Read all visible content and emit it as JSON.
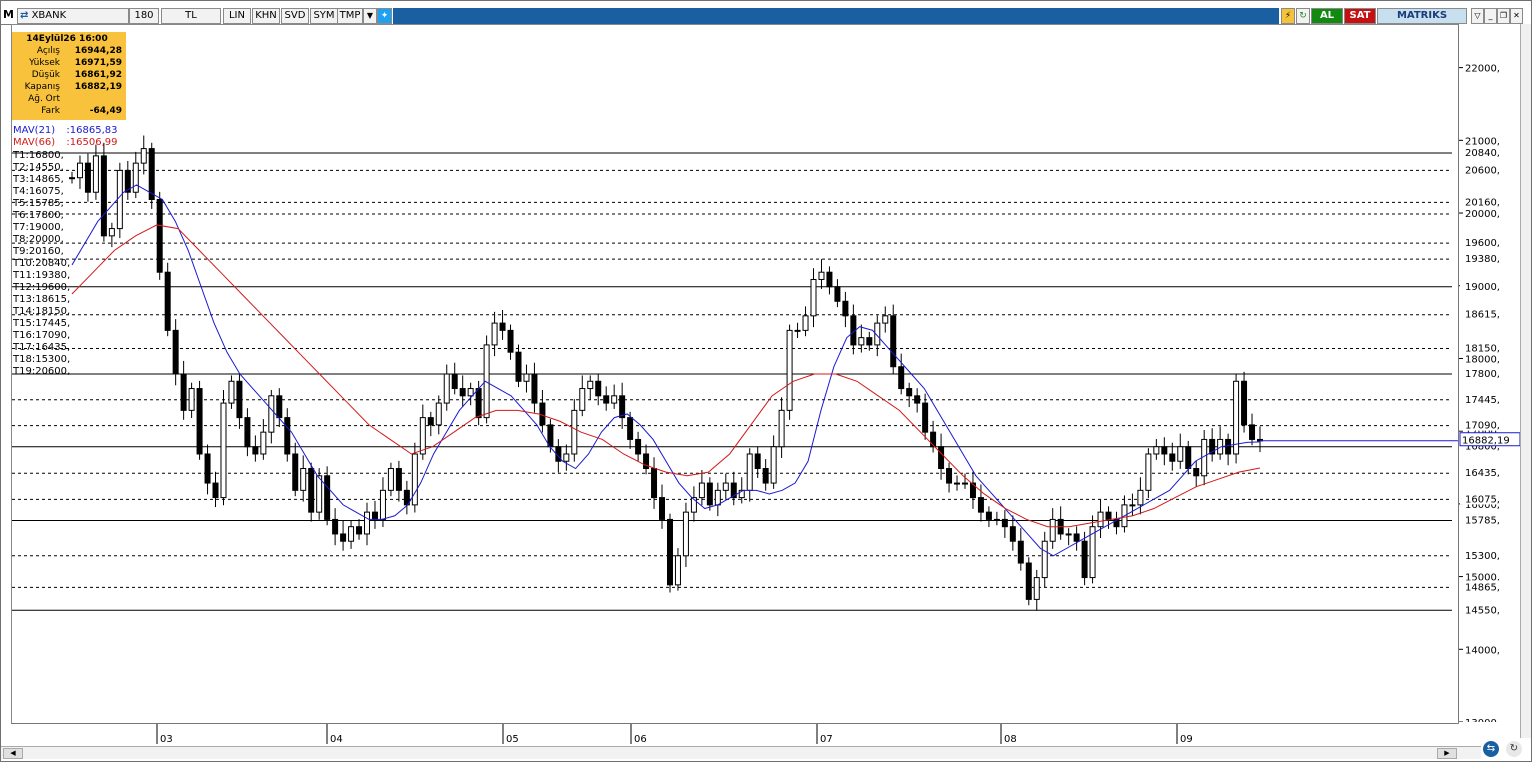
{
  "toolbar": {
    "logo": "M",
    "symbol": "XBANK",
    "period": "180",
    "currency": "TL",
    "buttons": [
      "LIN",
      "KHN",
      "SVD",
      "SYM",
      "TMP"
    ],
    "buy_label": "AL",
    "sell_label": "SAT",
    "brand": "MATRIKS",
    "colors": {
      "bar": "#1a5fa0",
      "buy": "#128a12",
      "sell": "#c51111",
      "brand_bg": "#c8dff0"
    }
  },
  "info_box": {
    "date": "14Eylül26 16:00",
    "rows": [
      {
        "label": "Açılış",
        "value": "16944,28"
      },
      {
        "label": "Yüksek",
        "value": "16971,59"
      },
      {
        "label": "Düşük",
        "value": "16861,92"
      },
      {
        "label": "Kapanış",
        "value": "16882,19"
      },
      {
        "label": "Ağ. Ort",
        "value": ""
      },
      {
        "label": "Fark",
        "value": "-64,49"
      }
    ]
  },
  "mav": [
    {
      "label": "MAV(21)",
      "value": ":16865,83",
      "color": "#1a1ad4"
    },
    {
      "label": "MAV(66)",
      "value": ":16506,99",
      "color": "#d21a1a"
    }
  ],
  "targets": [
    "T1:16800,",
    "T2:14550,",
    "T3:14865,",
    "T4:16075,",
    "T5:15785,",
    "T6:17800,",
    "T7:19000,",
    "T8:20000,",
    "T9:20160,",
    "T10:20840,",
    "T11:19380,",
    "T12:19600,",
    "T13:18615,",
    "T14:18150,",
    "T15:17445,",
    "T16:17090,",
    "T17:16435,",
    "T18:15300,",
    "T19:20600,"
  ],
  "chart_data": {
    "type": "candlestick",
    "ylim": [
      13000,
      22600
    ],
    "y_ticks": [
      "22000,",
      "21000,",
      "20000,",
      "19000,",
      "18000,",
      "17000,",
      "16000,",
      "15000,",
      "14000,",
      "13000,"
    ],
    "x_ticks": [
      "03",
      "04",
      "05",
      "06",
      "07",
      "08",
      "09"
    ],
    "last_price_label": "16882,19",
    "level_labels": [
      "20840,",
      "20600,",
      "20160,",
      "19600,",
      "19380,",
      "19000,",
      "18615,",
      "18150,",
      "17800,",
      "17445,",
      "17090,",
      "16800,",
      "16435,",
      "16075,",
      "15785,",
      "15300,",
      "14865,",
      "14550,"
    ],
    "levels": [
      {
        "value": 20840,
        "style": "solid"
      },
      {
        "value": 20600,
        "style": "dashed"
      },
      {
        "value": 20160,
        "style": "dashed"
      },
      {
        "value": 20000,
        "style": "dashed"
      },
      {
        "value": 19600,
        "style": "dashed"
      },
      {
        "value": 19380,
        "style": "dashed"
      },
      {
        "value": 19000,
        "style": "solid"
      },
      {
        "value": 18615,
        "style": "dashed"
      },
      {
        "value": 18150,
        "style": "dashed"
      },
      {
        "value": 17800,
        "style": "solid"
      },
      {
        "value": 17445,
        "style": "dashed"
      },
      {
        "value": 17090,
        "style": "dashed"
      },
      {
        "value": 16800,
        "style": "solid"
      },
      {
        "value": 16435,
        "style": "dashed"
      },
      {
        "value": 16075,
        "style": "dashed"
      },
      {
        "value": 15785,
        "style": "solid"
      },
      {
        "value": 15300,
        "style": "dashed"
      },
      {
        "value": 14865,
        "style": "dashed"
      },
      {
        "value": 14550,
        "style": "solid"
      }
    ],
    "price_path": [
      20500,
      20700,
      20300,
      20800,
      19700,
      19800,
      20600,
      20300,
      20700,
      20900,
      20200,
      19200,
      18400,
      17800,
      17300,
      17600,
      16700,
      16300,
      16100,
      17400,
      17700,
      17200,
      16800,
      16700,
      17000,
      17500,
      17200,
      16700,
      16200,
      16500,
      15900,
      16400,
      15800,
      15600,
      15500,
      15700,
      15600,
      15900,
      15800,
      16200,
      16500,
      16200,
      16000,
      16700,
      17200,
      17100,
      17400,
      17800,
      17600,
      17500,
      17600,
      17200,
      18200,
      18500,
      18400,
      18100,
      17700,
      17800,
      17400,
      17100,
      16800,
      16600,
      16700,
      17300,
      17600,
      17700,
      17500,
      17400,
      17500,
      17200,
      16900,
      16700,
      16500,
      16100,
      15800,
      14900,
      15300,
      15900,
      16100,
      16300,
      16000,
      16200,
      16300,
      16100,
      16200,
      16700,
      16500,
      16300,
      16800,
      17300,
      18400,
      18400,
      18600,
      19100,
      19200,
      19000,
      18800,
      18600,
      18200,
      18300,
      18200,
      18500,
      18600,
      17900,
      17600,
      17500,
      17400,
      17000,
      16800,
      16500,
      16300,
      16300,
      16300,
      16100,
      15900,
      15800,
      15800,
      15700,
      15500,
      15200,
      14700,
      15000,
      15500,
      15800,
      15600,
      15600,
      15500,
      15000,
      15700,
      15900,
      15800,
      15700,
      16000,
      16000,
      16200,
      16700,
      16800,
      16700,
      16600,
      16800,
      16500,
      16400,
      16900,
      16700,
      16900,
      16700,
      17700,
      17100,
      16900,
      16880
    ],
    "ma21": [
      19300,
      19600,
      19900,
      20100,
      20300,
      20400,
      20300,
      20200,
      19900,
      19500,
      19000,
      18500,
      18100,
      17800,
      17600,
      17400,
      17200,
      17000,
      16700,
      16400,
      16200,
      16000,
      15900,
      15800,
      15800,
      15850,
      16000,
      16300,
      16700,
      17000,
      17300,
      17500,
      17700,
      17600,
      17500,
      17300,
      17100,
      16800,
      16600,
      16500,
      16700,
      17000,
      17200,
      17250,
      17100,
      16900,
      16600,
      16300,
      16100,
      15950,
      16000,
      16100,
      16200,
      16200,
      16150,
      16200,
      16300,
      16600,
      17300,
      17900,
      18300,
      18450,
      18400,
      18200,
      18000,
      17800,
      17600,
      17300,
      17000,
      16700,
      16400,
      16200,
      16000,
      15800,
      15600,
      15400,
      15300,
      15400,
      15500,
      15600,
      15700,
      15800,
      15900,
      16000,
      16100,
      16200,
      16400,
      16600,
      16700,
      16800,
      16830,
      16860,
      16866
    ],
    "ma66": [
      18900,
      19200,
      19500,
      19700,
      19850,
      19800,
      19500,
      19200,
      18900,
      18600,
      18300,
      18000,
      17700,
      17400,
      17100,
      16900,
      16700,
      16800,
      17000,
      17200,
      17300,
      17300,
      17250,
      17150,
      17000,
      16900,
      16700,
      16550,
      16450,
      16400,
      16450,
      16700,
      17100,
      17500,
      17700,
      17800,
      17800,
      17700,
      17500,
      17300,
      17000,
      16700,
      16400,
      16150,
      15950,
      15800,
      15700,
      15700,
      15750,
      15800,
      15850,
      15950,
      16100,
      16250,
      16350,
      16450,
      16507
    ]
  },
  "right_axis_colors": {
    "last_price_bg": "#ffffff"
  }
}
